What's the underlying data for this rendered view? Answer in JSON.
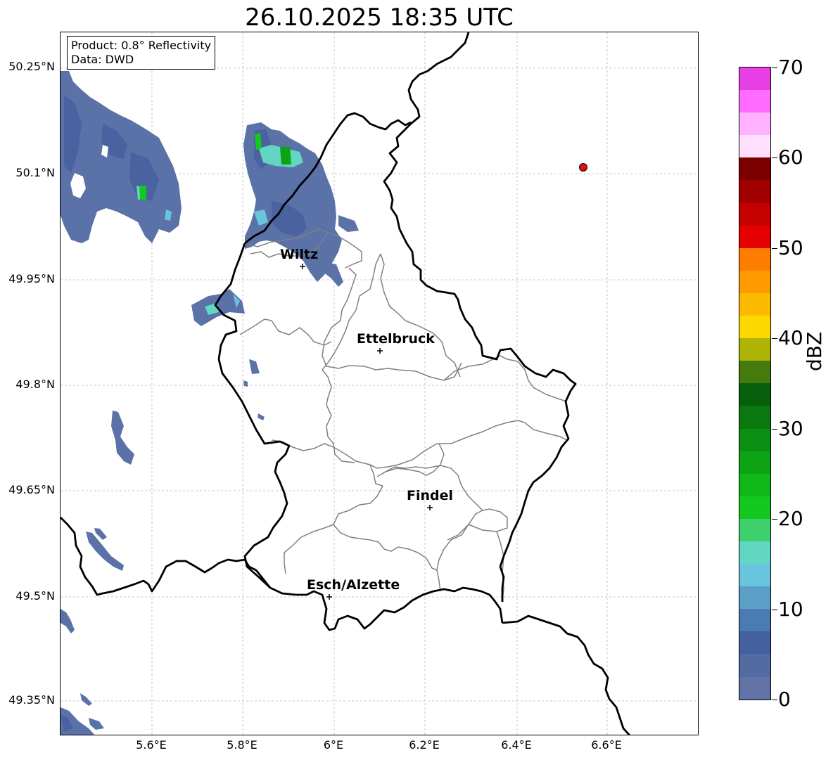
{
  "title": "26.10.2025 18:35 UTC",
  "info": {
    "product": "Product: 0.8° Reflectivity",
    "data": "Data: DWD"
  },
  "axes": {
    "lat_labels": [
      "50.25°N",
      "50.1°N",
      "49.95°N",
      "49.8°N",
      "49.65°N",
      "49.5°N",
      "49.35°N"
    ],
    "lon_labels": [
      "5.6°E",
      "5.8°E",
      "6°E",
      "6.2°E",
      "6.4°E",
      "6.6°E"
    ]
  },
  "cities": [
    {
      "name": "Wiltz",
      "lon": 5.93,
      "lat": 49.97
    },
    {
      "name": "Ettelbruck",
      "lon": 6.1,
      "lat": 49.85
    },
    {
      "name": "Findel",
      "lon": 6.21,
      "lat": 49.63
    },
    {
      "name": "Esch/Alzette",
      "lon": 5.99,
      "lat": 49.5
    }
  ],
  "marker": {
    "lon": 6.55,
    "lat": 50.11,
    "color": "#e01010"
  },
  "colorbar": {
    "unit": "dBZ",
    "tick_labels": [
      "0",
      "10",
      "20",
      "30",
      "40",
      "50",
      "60",
      "70"
    ],
    "min": 0,
    "max": 70,
    "step": 2.5,
    "colors": [
      "#6373a6",
      "#536aa3",
      "#4560a0",
      "#4a7bb1",
      "#5b9fc8",
      "#68c5dd",
      "#62d6c2",
      "#3fd06e",
      "#13c81e",
      "#10b818",
      "#0ea215",
      "#0b8f12",
      "#08780f",
      "#06600b",
      "#457a0c",
      "#adb406",
      "#fdd800",
      "#fdb900",
      "#fe9a00",
      "#fe7c00",
      "#e40000",
      "#c40000",
      "#a00000",
      "#7b0000",
      "#ffe0ff",
      "#ffb2ff",
      "#ff6cff",
      "#e83ee8"
    ]
  }
}
